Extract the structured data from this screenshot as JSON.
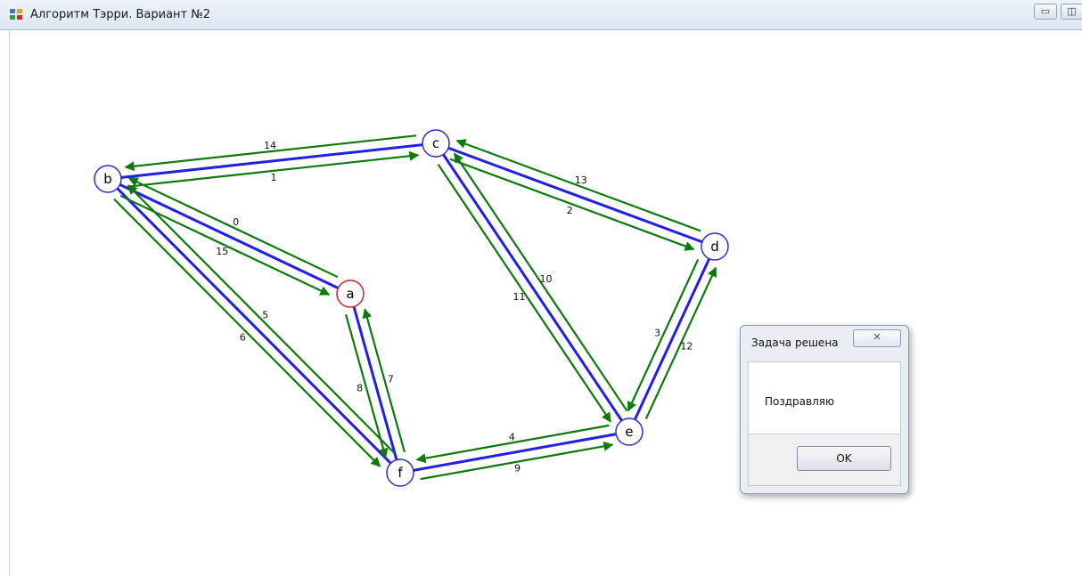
{
  "window": {
    "title": "Алгоритм Тэрри. Вариант №2",
    "minimize_glyph": "▭",
    "maximize_glyph": "◫"
  },
  "colors": {
    "edge": "#1f1fe6",
    "arrow": "#0a7a0a",
    "node_border": "#2b2bd6",
    "start_node_border": "#d42020"
  },
  "graph": {
    "start_node": "a",
    "nodes": [
      {
        "id": "a",
        "label": "a"
      },
      {
        "id": "b",
        "label": "b"
      },
      {
        "id": "c",
        "label": "c"
      },
      {
        "id": "d",
        "label": "d"
      },
      {
        "id": "e",
        "label": "e"
      },
      {
        "id": "f",
        "label": "f"
      }
    ],
    "edges": [
      {
        "u": "b",
        "v": "c"
      },
      {
        "u": "c",
        "v": "d"
      },
      {
        "u": "d",
        "v": "e"
      },
      {
        "u": "c",
        "v": "e"
      },
      {
        "u": "e",
        "v": "f"
      },
      {
        "u": "a",
        "v": "f"
      },
      {
        "u": "b",
        "v": "f"
      },
      {
        "u": "a",
        "v": "b"
      }
    ],
    "traversal": [
      {
        "step": "0",
        "from": "a",
        "to": "b"
      },
      {
        "step": "1",
        "from": "b",
        "to": "c"
      },
      {
        "step": "2",
        "from": "c",
        "to": "d"
      },
      {
        "step": "3",
        "from": "d",
        "to": "e"
      },
      {
        "step": "4",
        "from": "e",
        "to": "f"
      },
      {
        "step": "5",
        "from": "f",
        "to": "b"
      },
      {
        "step": "6",
        "from": "b",
        "to": "f"
      },
      {
        "step": "7",
        "from": "f",
        "to": "a"
      },
      {
        "step": "8",
        "from": "a",
        "to": "f"
      },
      {
        "step": "9",
        "from": "f",
        "to": "e"
      },
      {
        "step": "10",
        "from": "e",
        "to": "c"
      },
      {
        "step": "11",
        "from": "c",
        "to": "e"
      },
      {
        "step": "12",
        "from": "e",
        "to": "d"
      },
      {
        "step": "13",
        "from": "d",
        "to": "c"
      },
      {
        "step": "14",
        "from": "c",
        "to": "b"
      },
      {
        "step": "15",
        "from": "b",
        "to": "a"
      }
    ]
  },
  "dialog": {
    "title": "Задача решена",
    "close_glyph": "✕",
    "message": "Поздравляю",
    "ok_label": "OK"
  }
}
